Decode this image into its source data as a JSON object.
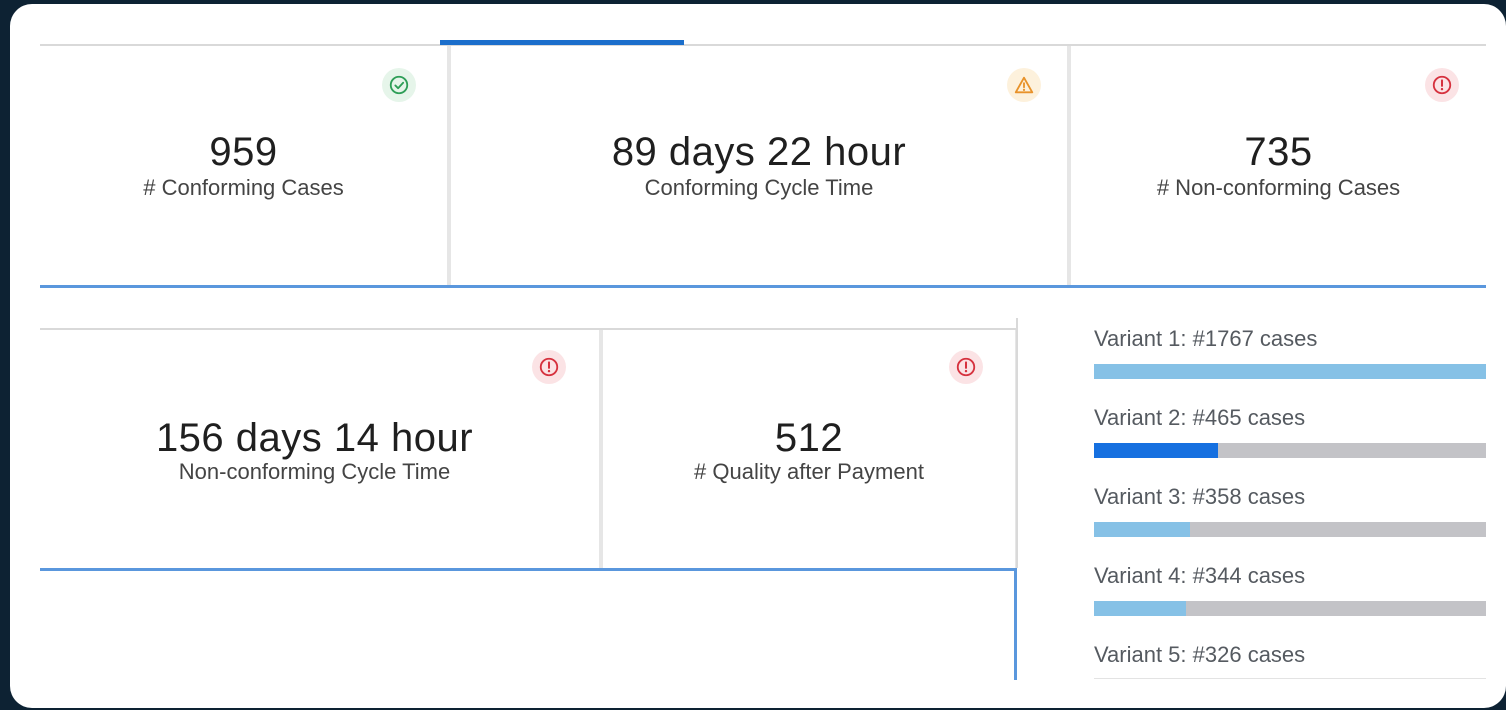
{
  "colors": {
    "accent": "#1b6ecb",
    "divider": "#5a97dd",
    "ok": "#2e9e57",
    "warn": "#e8922a",
    "error": "#d6313e",
    "bar_light": "#86c1e6",
    "bar_dark": "#1670e0",
    "bar_track": "#c3c3c7"
  },
  "kpis_top": [
    {
      "value": "959",
      "label": "# Conforming Cases",
      "status": "ok",
      "icon": "check-circle-icon"
    },
    {
      "value": "89 days 22 hour",
      "label": "Conforming Cycle Time",
      "status": "warning",
      "icon": "warning-triangle-icon"
    },
    {
      "value": "735",
      "label": "# Non-conforming Cases",
      "status": "error",
      "icon": "alert-circle-icon"
    }
  ],
  "kpis_bottom": [
    {
      "value": "156 days 14 hour",
      "label": "Non-conforming Cycle Time",
      "status": "error",
      "icon": "alert-circle-icon"
    },
    {
      "value": "512",
      "label": "# Quality after Payment",
      "status": "error",
      "icon": "alert-circle-icon"
    }
  ],
  "variants": [
    {
      "label": "Variant 1: #1767 cases",
      "cases": 1767,
      "share": 1.0,
      "color": "#86c1e6"
    },
    {
      "label": "Variant 2: #465 cases",
      "cases": 465,
      "share": 0.317,
      "color": "#1670e0"
    },
    {
      "label": "Variant 3: #358 cases",
      "cases": 358,
      "share": 0.244,
      "color": "#86c1e6"
    },
    {
      "label": "Variant 4: #344 cases",
      "cases": 344,
      "share": 0.234,
      "color": "#86c1e6"
    },
    {
      "label": "Variant 5: #326 cases",
      "cases": 326,
      "share": null,
      "color": "#86c1e6"
    }
  ]
}
